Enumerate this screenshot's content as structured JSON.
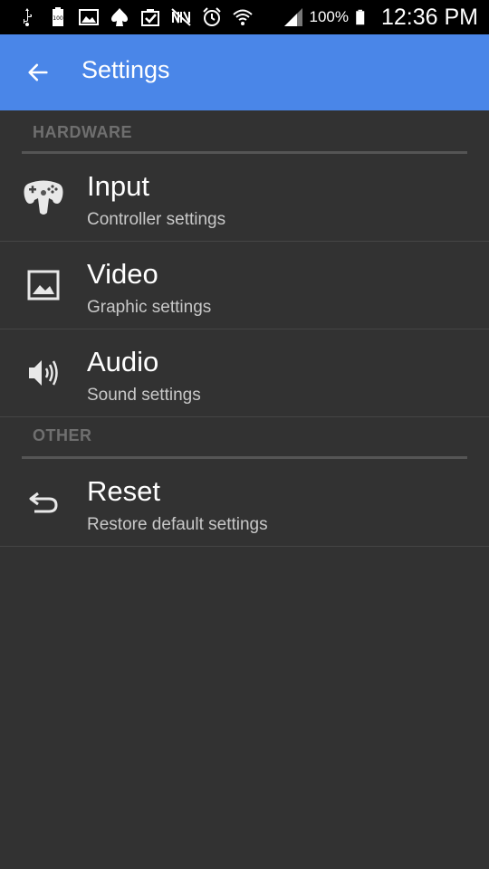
{
  "status_bar": {
    "icons": [
      "usb-icon",
      "battery-full-icon",
      "gallery-icon",
      "spade-icon",
      "clipboard-check-icon",
      "nfc-muted-icon",
      "alarm-icon",
      "wifi-icon",
      "signal-icon",
      "battery-icon"
    ],
    "battery_percent": "100%",
    "clock": "12:36 PM"
  },
  "app_bar": {
    "title": "Settings",
    "back_icon": "arrow-back-icon",
    "color": "#4a86e8"
  },
  "sections": [
    {
      "header": "HARDWARE",
      "items": [
        {
          "title": "Input",
          "subtitle": "Controller settings",
          "icon": "gamepad-icon"
        },
        {
          "title": "Video",
          "subtitle": "Graphic settings",
          "icon": "image-icon"
        },
        {
          "title": "Audio",
          "subtitle": "Sound settings",
          "icon": "speaker-icon"
        }
      ]
    },
    {
      "header": "OTHER",
      "items": [
        {
          "title": "Reset",
          "subtitle": "Restore default settings",
          "icon": "undo-icon"
        }
      ]
    }
  ]
}
